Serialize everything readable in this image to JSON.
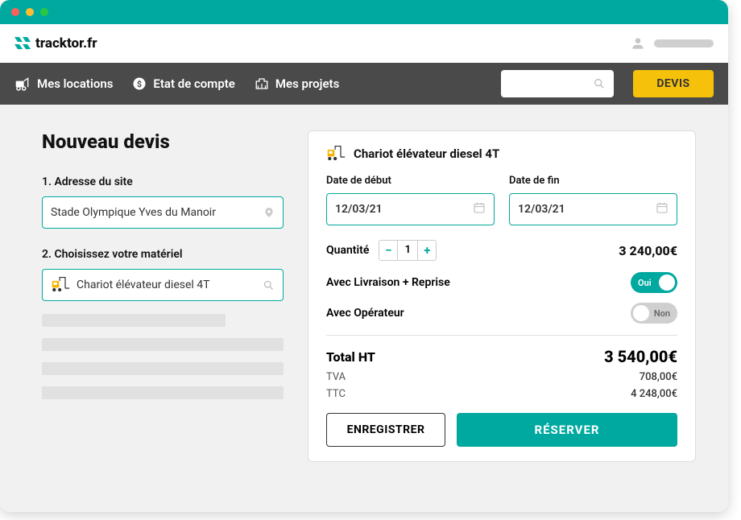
{
  "brand": "tracktor.fr",
  "nav": {
    "locations": "Mes locations",
    "account": "Etat de compte",
    "projects": "Mes projets",
    "devis_btn": "DEVIS"
  },
  "page": {
    "title": "Nouveau devis",
    "step1_label": "1. Adresse du site",
    "step1_value": "Stade Olympique Yves du Manoir",
    "step2_label": "2. Choisissez votre matériel",
    "step2_value": "Chariot élévateur diesel 4T"
  },
  "card": {
    "product": "Chariot élévateur diesel 4T",
    "date_start_label": "Date de début",
    "date_start": "12/03/21",
    "date_end_label": "Date de fin",
    "date_end": "12/03/21",
    "qty_label": "Quantité",
    "qty": "1",
    "line_price": "3 240,00€",
    "delivery_label": "Avec Livraison + Reprise",
    "delivery_on": "Oui",
    "operator_label": "Avec Opérateur",
    "operator_off": "Non",
    "total_ht_label": "Total HT",
    "total_ht": "3 540,00€",
    "tva_label": "TVA",
    "tva": "708,00€",
    "ttc_label": "TTC",
    "ttc": "4 248,00€",
    "save_btn": "ENREGISTRER",
    "reserve_btn": "RÉSERVER"
  }
}
